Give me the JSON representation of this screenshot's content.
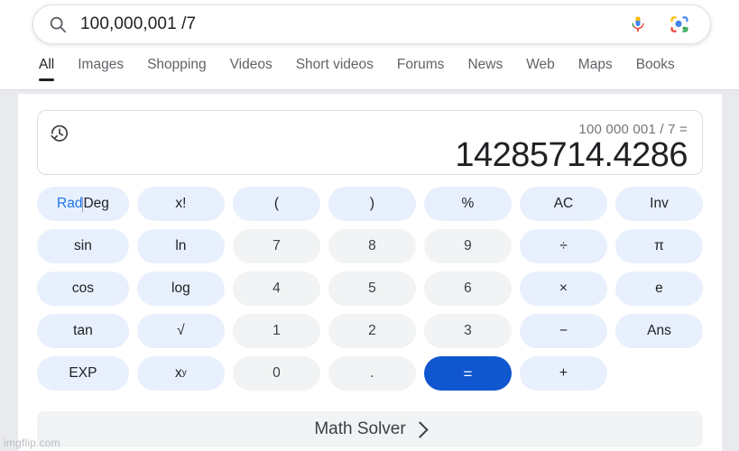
{
  "search": {
    "query": "100,000,001 /7",
    "icon": "search-icon",
    "mic_icon": "microphone-icon",
    "lens_icon": "google-lens-icon"
  },
  "tabs": [
    {
      "label": "All",
      "active": true
    },
    {
      "label": "Images",
      "active": false
    },
    {
      "label": "Shopping",
      "active": false
    },
    {
      "label": "Videos",
      "active": false
    },
    {
      "label": "Short videos",
      "active": false
    },
    {
      "label": "Forums",
      "active": false
    },
    {
      "label": "News",
      "active": false
    },
    {
      "label": "Web",
      "active": false
    },
    {
      "label": "Maps",
      "active": false
    },
    {
      "label": "Books",
      "active": false
    }
  ],
  "calculator": {
    "history_icon": "history-icon",
    "expression": "100 000 001 / 7 =",
    "result": "14285714.4286",
    "angle_mode": {
      "rad_label": "Rad",
      "deg_label": "Deg",
      "selected": "Rad",
      "active_color": "#1a73e8"
    },
    "keys": [
      {
        "label": "Rad|Deg",
        "type": "radeg",
        "name": "rad-deg-toggle"
      },
      {
        "label": "x!",
        "type": "func",
        "name": "factorial-button"
      },
      {
        "label": "(",
        "type": "func",
        "name": "open-paren-button"
      },
      {
        "label": ")",
        "type": "func",
        "name": "close-paren-button"
      },
      {
        "label": "%",
        "type": "func",
        "name": "percent-button"
      },
      {
        "label": "AC",
        "type": "func",
        "name": "all-clear-button"
      },
      {
        "label": "Inv",
        "type": "func",
        "name": "inverse-button"
      },
      {
        "label": "sin",
        "type": "func",
        "name": "sin-button"
      },
      {
        "label": "ln",
        "type": "func",
        "name": "ln-button"
      },
      {
        "label": "7",
        "type": "num",
        "name": "digit-7-button"
      },
      {
        "label": "8",
        "type": "num",
        "name": "digit-8-button"
      },
      {
        "label": "9",
        "type": "num",
        "name": "digit-9-button"
      },
      {
        "label": "÷",
        "type": "func",
        "name": "divide-button"
      },
      {
        "label": "π",
        "type": "func",
        "name": "pi-button"
      },
      {
        "label": "cos",
        "type": "func",
        "name": "cos-button"
      },
      {
        "label": "log",
        "type": "func",
        "name": "log-button"
      },
      {
        "label": "4",
        "type": "num",
        "name": "digit-4-button"
      },
      {
        "label": "5",
        "type": "num",
        "name": "digit-5-button"
      },
      {
        "label": "6",
        "type": "num",
        "name": "digit-6-button"
      },
      {
        "label": "×",
        "type": "func",
        "name": "multiply-button"
      },
      {
        "label": "e",
        "type": "func",
        "name": "e-button"
      },
      {
        "label": "tan",
        "type": "func",
        "name": "tan-button"
      },
      {
        "label": "√",
        "type": "func",
        "name": "square-root-button"
      },
      {
        "label": "1",
        "type": "num",
        "name": "digit-1-button"
      },
      {
        "label": "2",
        "type": "num",
        "name": "digit-2-button"
      },
      {
        "label": "3",
        "type": "num",
        "name": "digit-3-button"
      },
      {
        "label": "−",
        "type": "func",
        "name": "minus-button"
      },
      {
        "label": "Ans",
        "type": "func",
        "name": "answer-button"
      },
      {
        "label": "EXP",
        "type": "func",
        "name": "exponent-button"
      },
      {
        "label": "x^y",
        "type": "power",
        "name": "power-button"
      },
      {
        "label": "0",
        "type": "num",
        "name": "digit-0-button"
      },
      {
        "label": ".",
        "type": "num",
        "name": "decimal-point-button"
      },
      {
        "label": "=",
        "type": "equals",
        "name": "equals-button"
      },
      {
        "label": "+",
        "type": "func",
        "name": "plus-button"
      }
    ],
    "equals_color": "#0f56cf"
  },
  "math_solver": {
    "label": "Math Solver",
    "chevron": "chevron-right-icon"
  },
  "watermark": "imgflip.com"
}
